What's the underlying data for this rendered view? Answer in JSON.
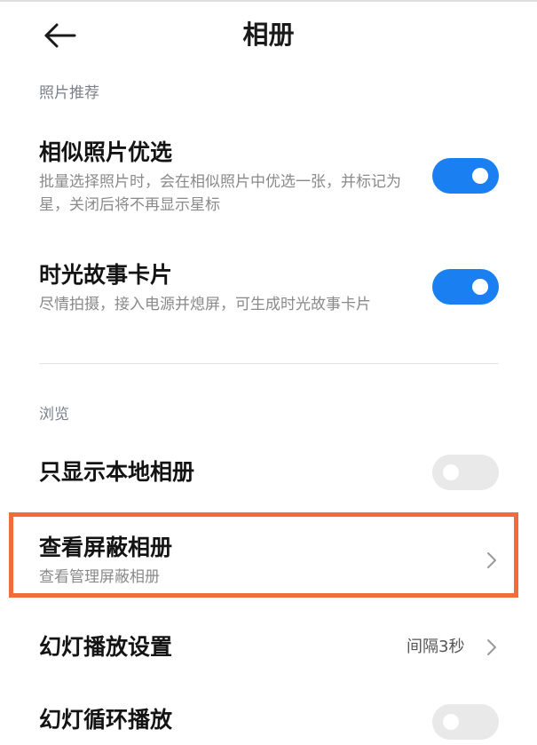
{
  "header": {
    "title": "相册",
    "back_icon": "back-arrow-icon"
  },
  "sections": {
    "photo_recommend": {
      "label": "照片推荐",
      "items": [
        {
          "title": "相似照片优选",
          "subtitle": "批量选择照片时，会在相似照片中优选一张，并标记为星，关闭后将不再显示星标",
          "toggle": "on"
        },
        {
          "title": "时光故事卡片",
          "subtitle": "尽情拍摄，接入电源并熄屏，可生成时光故事卡片",
          "toggle": "on"
        }
      ]
    },
    "browse": {
      "label": "浏览",
      "items": [
        {
          "title": "只显示本地相册",
          "toggle": "off"
        },
        {
          "title": "查看屏蔽相册",
          "subtitle": "查看管理屏蔽相册",
          "chevron_icon": "chevron-right-icon"
        },
        {
          "title": "幻灯播放设置",
          "value": "间隔3秒",
          "chevron_icon": "chevron-right-icon"
        },
        {
          "title": "幻灯循环播放",
          "toggle": "off"
        }
      ]
    }
  },
  "colors": {
    "accent": "#1a7ff0",
    "highlight": "#f26b3a",
    "toggle_off": "#e9e9e9",
    "section_label": "#7a7f8a"
  }
}
